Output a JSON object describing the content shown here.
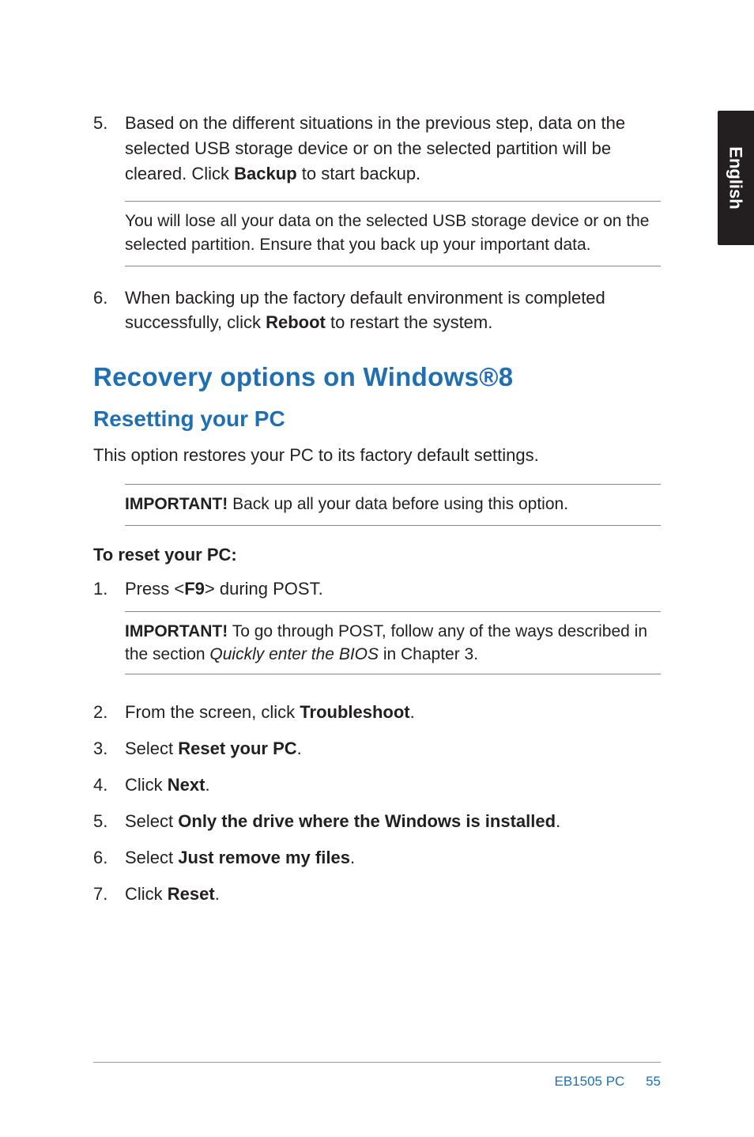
{
  "side_label": "English",
  "steps_top": [
    {
      "num": "5.",
      "text_parts": [
        "Based on the different situations in the previous step, data on the selected USB storage device or on the selected partition will be cleared. Click ",
        "Backup",
        " to start backup."
      ]
    },
    {
      "num": "6.",
      "text_parts": [
        "When backing up the factory default environment is completed successfully, click ",
        "Reboot",
        " to restart the system."
      ]
    }
  ],
  "note_usb": "You will lose all your data on the selected USB storage device or on the selected partition. Ensure that you back up your important data.",
  "h1": "Recovery options on Windows®8",
  "h2": "Resetting your PC",
  "intro": "This option restores your PC to its factory default settings.",
  "important1_label": "IMPORTANT!",
  "important1_text": "  Back up all your data before using this option.",
  "reset_heading": "To reset your PC:",
  "reset_steps": [
    {
      "num": "1.",
      "parts": [
        "Press <",
        "F9",
        "> during POST."
      ]
    },
    {
      "num": "2.",
      "parts": [
        "From the screen, click ",
        "Troubleshoot",
        "."
      ]
    },
    {
      "num": "3.",
      "parts": [
        "Select ",
        "Reset your PC",
        "."
      ]
    },
    {
      "num": "4.",
      "parts": [
        "Click ",
        "Next",
        "."
      ]
    },
    {
      "num": "5.",
      "parts": [
        "Select ",
        "Only the drive where the Windows is installed",
        "."
      ]
    },
    {
      "num": "6.",
      "parts": [
        "Select ",
        "Just remove my files",
        "."
      ]
    },
    {
      "num": "7.",
      "parts": [
        "Click ",
        "Reset",
        "."
      ]
    }
  ],
  "important2_label": "IMPORTANT!",
  "important2_pre": "  To go through POST, follow any of the ways described in the section ",
  "important2_italic": "Quickly enter the BIOS",
  "important2_post": " in Chapter 3.",
  "footer": {
    "model": "EB1505 PC",
    "page": "55"
  }
}
